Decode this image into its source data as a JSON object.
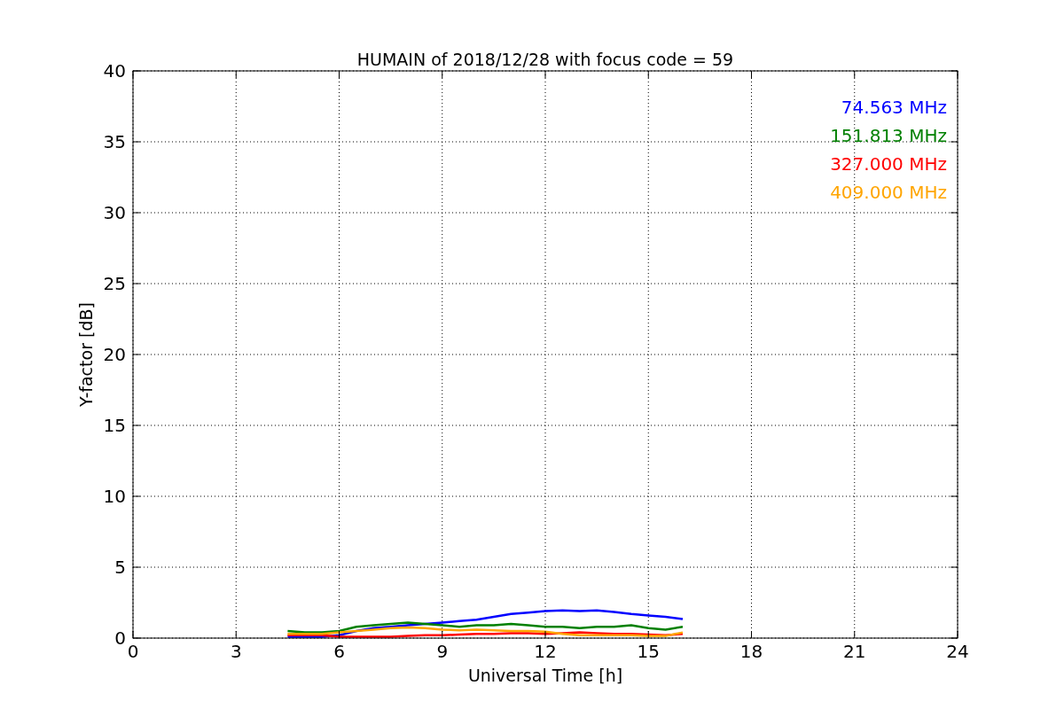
{
  "chart_data": {
    "type": "line",
    "title": "HUMAIN of 2018/12/28 with focus code = 59",
    "xlabel": "Universal Time [h]",
    "ylabel": "Y-factor [dB]",
    "x": [
      4.5,
      5,
      5.5,
      6,
      6.5,
      7,
      7.5,
      8,
      8.5,
      9,
      9.5,
      10,
      10.5,
      11,
      11.5,
      12,
      12.5,
      13,
      13.5,
      14,
      14.5,
      15,
      15.5,
      16
    ],
    "xlim": [
      0,
      24
    ],
    "ylim": [
      0,
      40
    ],
    "grid": true,
    "xticks": [
      0,
      3,
      6,
      9,
      12,
      15,
      18,
      21,
      24
    ],
    "yticks": [
      0,
      5,
      10,
      15,
      20,
      25,
      30,
      35,
      40
    ],
    "series": [
      {
        "name": "74.563 MHz",
        "color": "#0000ff",
        "values": [
          0.1,
          0.1,
          0.1,
          0.2,
          0.5,
          0.7,
          0.8,
          0.9,
          1.0,
          1.1,
          1.2,
          1.3,
          1.5,
          1.7,
          1.8,
          1.9,
          1.95,
          1.9,
          1.95,
          1.85,
          1.7,
          1.6,
          1.5,
          1.35
        ]
      },
      {
        "name": "151.813 MHz",
        "color": "#008000",
        "values": [
          0.5,
          0.4,
          0.4,
          0.5,
          0.8,
          0.9,
          1.0,
          1.1,
          1.0,
          0.9,
          0.8,
          0.9,
          0.9,
          1.0,
          0.9,
          0.8,
          0.8,
          0.7,
          0.8,
          0.8,
          0.9,
          0.7,
          0.6,
          0.8
        ]
      },
      {
        "name": "327.000 MHz",
        "color": "#ff0000",
        "values": [
          0.2,
          0.2,
          0.2,
          0.1,
          0.1,
          0.1,
          0.1,
          0.15,
          0.2,
          0.2,
          0.25,
          0.3,
          0.3,
          0.35,
          0.35,
          0.3,
          0.35,
          0.4,
          0.35,
          0.3,
          0.3,
          0.25,
          0.2,
          0.3
        ]
      },
      {
        "name": "409.000 MHz",
        "color": "#ffa500",
        "values": [
          0.3,
          0.3,
          0.3,
          0.4,
          0.5,
          0.6,
          0.7,
          0.75,
          0.7,
          0.6,
          0.55,
          0.6,
          0.55,
          0.5,
          0.5,
          0.45,
          0.3,
          0.2,
          0.2,
          0.2,
          0.2,
          0.15,
          0.15,
          0.4
        ]
      }
    ]
  }
}
